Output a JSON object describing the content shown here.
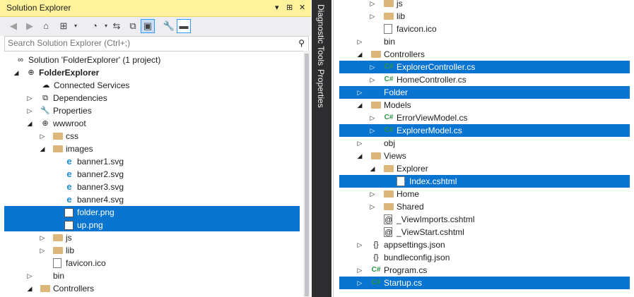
{
  "solution_explorer": {
    "title": "Solution Explorer",
    "title_buttons": [
      "▾",
      "⊞",
      "✕"
    ],
    "toolbar_icons": [
      "back-icon",
      "forward-icon",
      "home-icon",
      "switch-views-icon",
      "pending-changes-icon",
      "sync-icon",
      "collapse-all-icon",
      "show-all-files-icon",
      "properties-icon",
      "preview-icon"
    ],
    "search_placeholder": "Search Solution Explorer (Ctrl+;)",
    "tree": [
      {
        "label": "Solution 'FolderExplorer' (1 project)",
        "icon": "solution-icon",
        "arrow": ""
      },
      {
        "label": "FolderExplorer",
        "icon": "project-icon",
        "arrow": "◢",
        "bold": true
      },
      {
        "label": "Connected Services",
        "icon": "cloud-icon",
        "arrow": ""
      },
      {
        "label": "Dependencies",
        "icon": "dependencies-icon",
        "arrow": "▷"
      },
      {
        "label": "Properties",
        "icon": "wrench-icon",
        "arrow": "▷"
      },
      {
        "label": "wwwroot",
        "icon": "globe-icon",
        "arrow": "◢"
      },
      {
        "label": "css",
        "icon": "folder-icon",
        "arrow": "▷"
      },
      {
        "label": "images",
        "icon": "folder-open-icon",
        "arrow": "◢"
      },
      {
        "label": "banner1.svg",
        "icon": "svg-file-icon",
        "arrow": ""
      },
      {
        "label": "banner2.svg",
        "icon": "svg-file-icon",
        "arrow": ""
      },
      {
        "label": "banner3.svg",
        "icon": "svg-file-icon",
        "arrow": ""
      },
      {
        "label": "banner4.svg",
        "icon": "svg-file-icon",
        "arrow": ""
      },
      {
        "label": "folder.png",
        "icon": "image-file-icon",
        "arrow": "",
        "selected": true
      },
      {
        "label": "up.png",
        "icon": "image-file-icon",
        "arrow": "",
        "selected": true
      },
      {
        "label": "js",
        "icon": "folder-icon",
        "arrow": "▷"
      },
      {
        "label": "lib",
        "icon": "folder-icon",
        "arrow": "▷"
      },
      {
        "label": "favicon.ico",
        "icon": "file-icon",
        "arrow": ""
      },
      {
        "label": "bin",
        "icon": "hidden-folder-icon",
        "arrow": "▷"
      },
      {
        "label": "Controllers",
        "icon": "folder-icon",
        "arrow": "◢"
      }
    ]
  },
  "side_tabs": {
    "diagnostic": "Diagnostic Tools",
    "properties": "Properties"
  },
  "right_tree": [
    {
      "label": "js",
      "icon": "folder-icon",
      "arrow": "▷"
    },
    {
      "label": "lib",
      "icon": "folder-icon",
      "arrow": "▷"
    },
    {
      "label": "favicon.ico",
      "icon": "file-icon",
      "arrow": ""
    },
    {
      "label": "bin",
      "icon": "hidden-folder-icon",
      "arrow": "▷"
    },
    {
      "label": "Controllers",
      "icon": "folder-open-icon",
      "arrow": "◢"
    },
    {
      "label": "ExplorerController.cs",
      "icon": "cs-file-icon",
      "arrow": "▷",
      "selected": true
    },
    {
      "label": "HomeController.cs",
      "icon": "cs-file-icon",
      "arrow": "▷"
    },
    {
      "label": "Folder",
      "icon": "hidden-folder-icon",
      "arrow": "▷",
      "selected": true
    },
    {
      "label": "Models",
      "icon": "folder-open-icon",
      "arrow": "◢"
    },
    {
      "label": "ErrorViewModel.cs",
      "icon": "cs-file-icon",
      "arrow": "▷"
    },
    {
      "label": "ExplorerModel.cs",
      "icon": "cs-file-icon",
      "arrow": "▷",
      "selected": true
    },
    {
      "label": "obj",
      "icon": "hidden-folder-icon",
      "arrow": "▷"
    },
    {
      "label": "Views",
      "icon": "folder-open-icon",
      "arrow": "◢"
    },
    {
      "label": "Explorer",
      "icon": "folder-open-icon",
      "arrow": "◢"
    },
    {
      "label": "Index.cshtml",
      "icon": "cshtml-file-icon",
      "arrow": "",
      "selected": true
    },
    {
      "label": "Home",
      "icon": "folder-icon",
      "arrow": "▷"
    },
    {
      "label": "Shared",
      "icon": "folder-icon",
      "arrow": "▷"
    },
    {
      "label": "_ViewImports.cshtml",
      "icon": "cshtml-file-icon",
      "arrow": ""
    },
    {
      "label": "_ViewStart.cshtml",
      "icon": "cshtml-file-icon",
      "arrow": ""
    },
    {
      "label": "appsettings.json",
      "icon": "json-file-icon",
      "arrow": "▷"
    },
    {
      "label": "bundleconfig.json",
      "icon": "json-file-icon",
      "arrow": ""
    },
    {
      "label": "Program.cs",
      "icon": "cs-file-icon",
      "arrow": "▷"
    },
    {
      "label": "Startup.cs",
      "icon": "cs-file-icon",
      "arrow": "▷",
      "selected": true
    }
  ],
  "colors": {
    "selection": "#0a74d1",
    "title_bar": "#fff29d",
    "tab_strip": "#2d2d30"
  }
}
